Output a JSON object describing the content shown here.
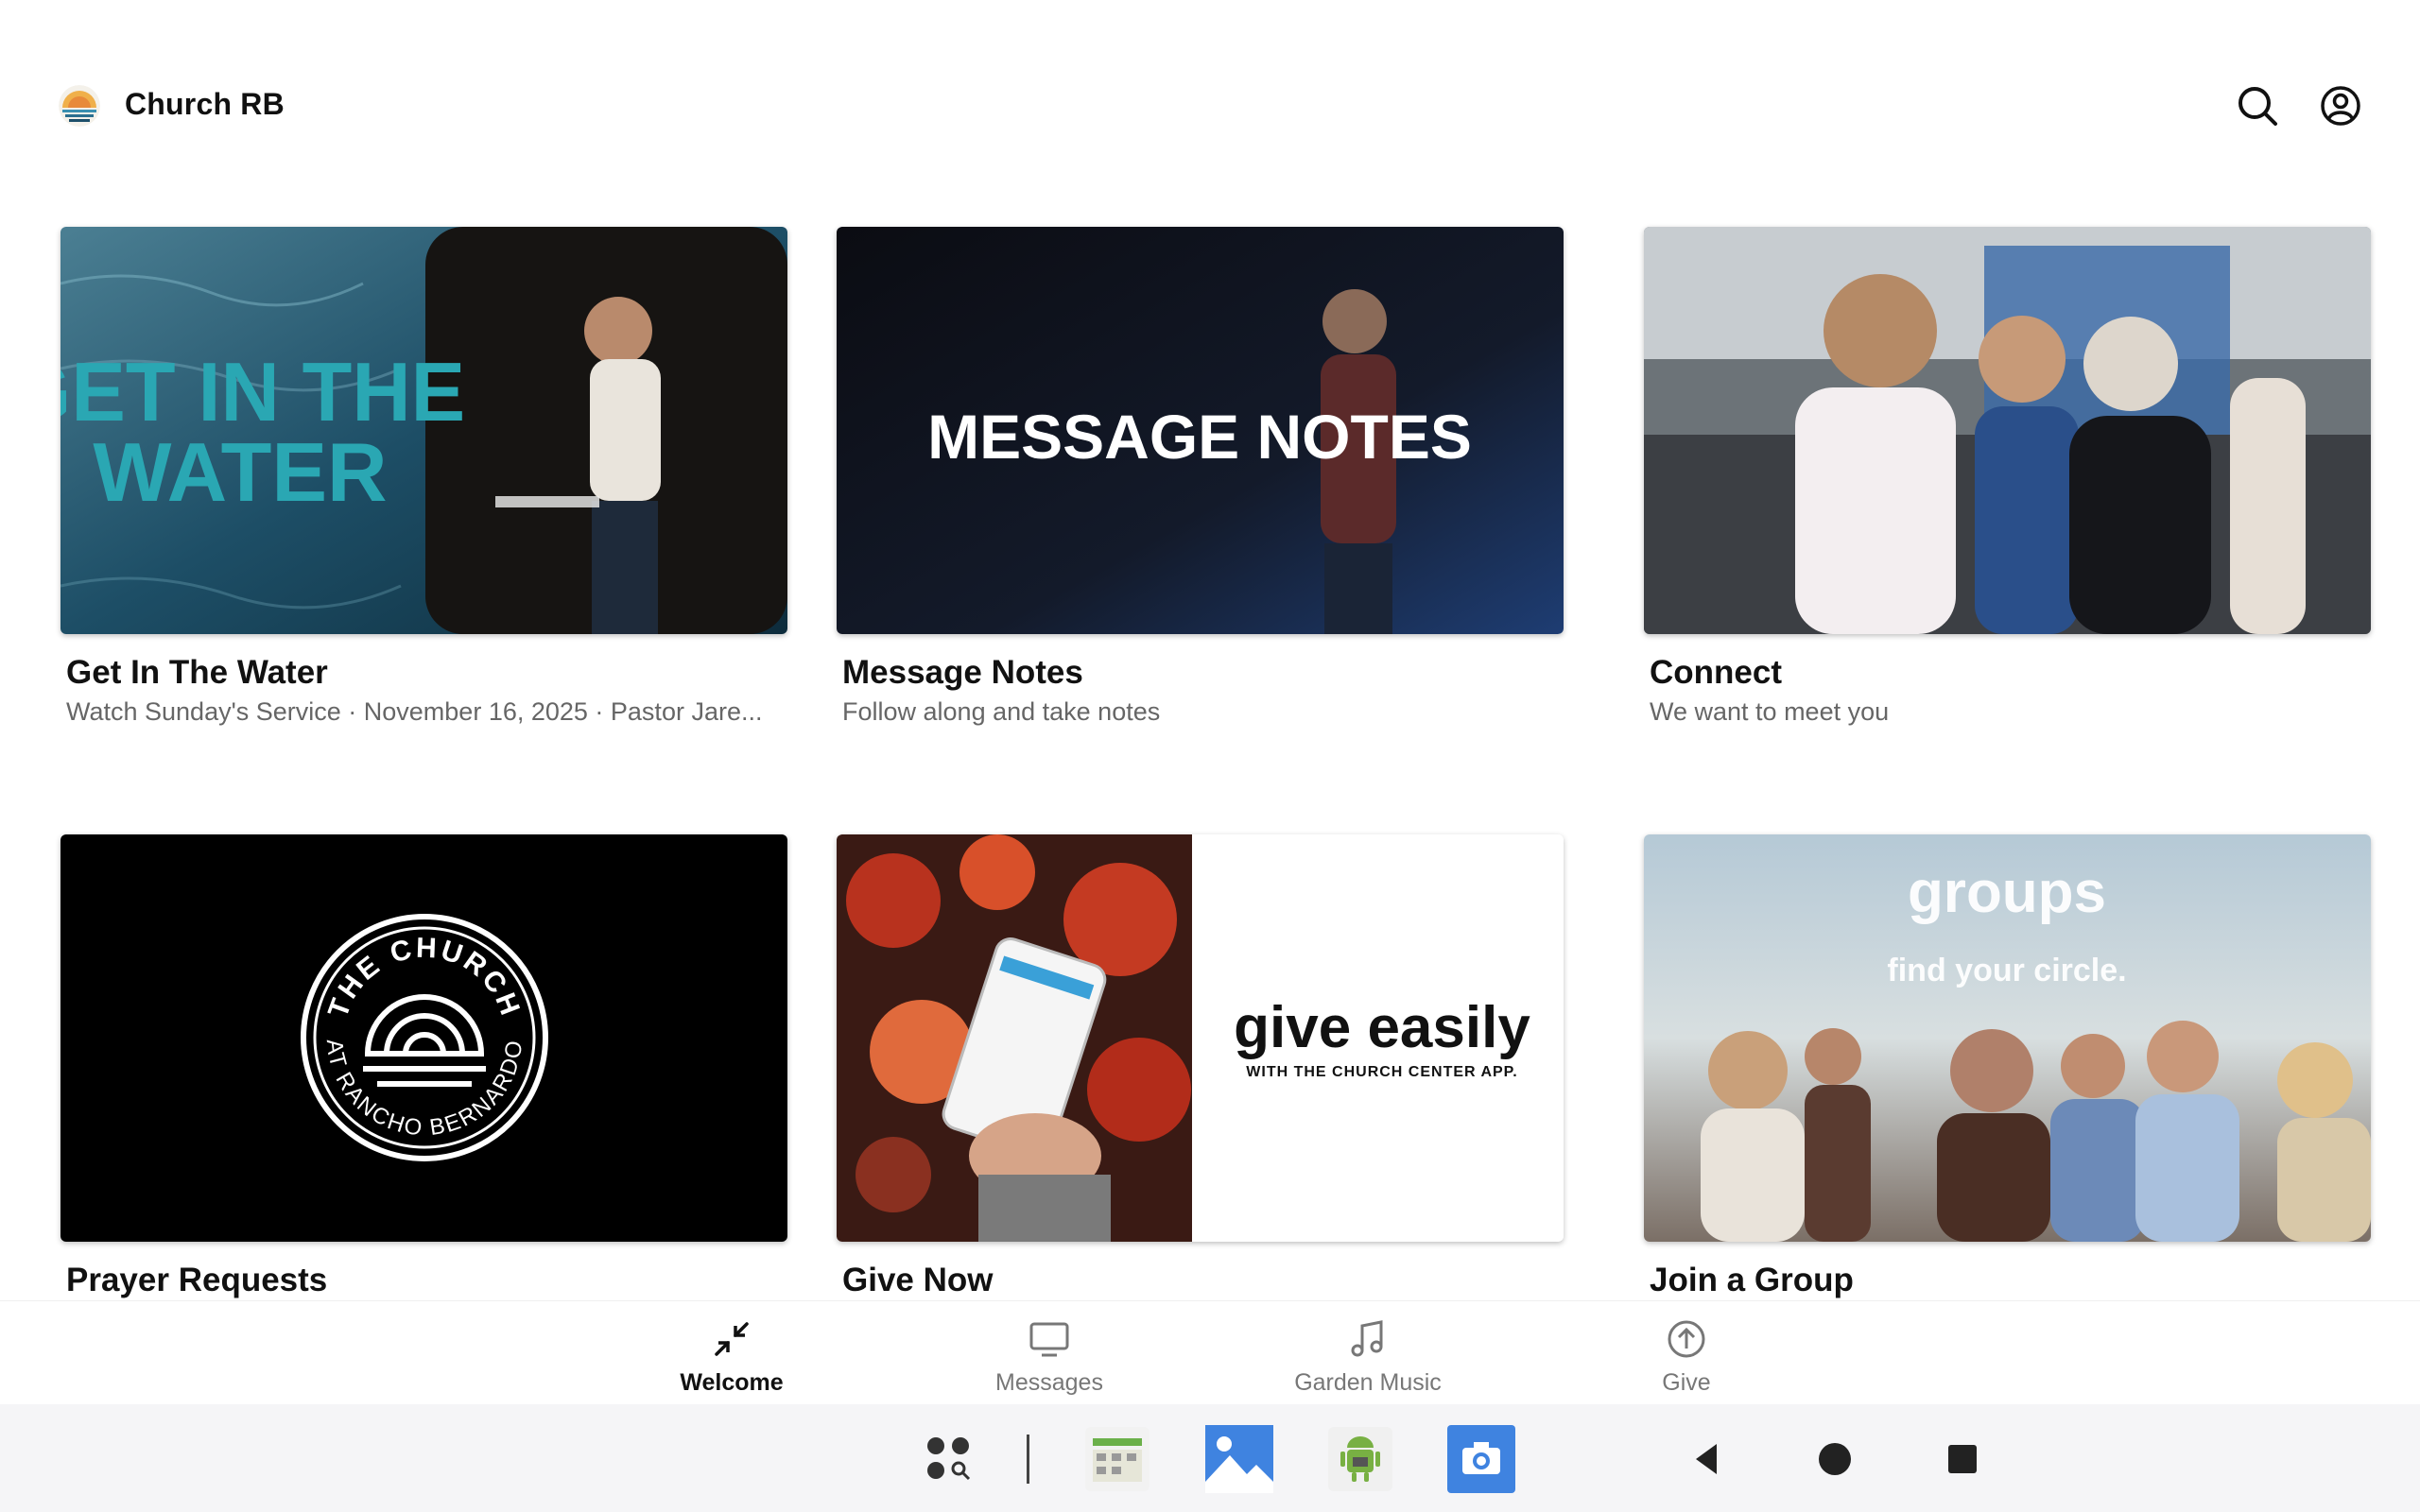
{
  "header": {
    "app_title": "Church RB",
    "icons": [
      "church-logo",
      "search-icon",
      "account-icon"
    ]
  },
  "cards": [
    {
      "title": "Get In The Water",
      "subtitle": "Watch Sunday's Service · November 16, 2025 · Pastor Jare...",
      "image_text": [
        "GET IN THE",
        "WATER"
      ]
    },
    {
      "title": "Message Notes",
      "subtitle": "Follow along and take notes",
      "image_text": [
        "MESSAGE NOTES"
      ]
    },
    {
      "title": "Connect",
      "subtitle": "We want to meet you",
      "image_text": []
    },
    {
      "title": "Prayer Requests",
      "subtitle": "",
      "image_text": [
        "THE CHURCH",
        "AT RANCHO BERNARDO"
      ]
    },
    {
      "title": "Give Now",
      "subtitle": "",
      "image_text": [
        "give easily",
        "WITH THE CHURCH CENTER APP."
      ]
    },
    {
      "title": "Join a Group",
      "subtitle": "",
      "image_text": [
        "groups",
        "find your circle."
      ]
    }
  ],
  "tabs": [
    {
      "label": "Welcome",
      "icon": "collapse-arrows-icon",
      "active": true
    },
    {
      "label": "Messages",
      "icon": "monitor-icon",
      "active": false
    },
    {
      "label": "Garden Music",
      "icon": "music-note-icon",
      "active": false
    },
    {
      "label": "Give",
      "icon": "arrow-up-circle-icon",
      "active": false
    }
  ],
  "system_bar": {
    "apps": [
      "app-drawer-icon",
      "calendar-app-icon",
      "gallery-app-icon",
      "android-app-icon",
      "camera-app-icon"
    ],
    "nav": [
      "back-icon",
      "home-icon",
      "recents-icon"
    ]
  },
  "colors": {
    "accent": "#111111",
    "inactive": "#777777",
    "system_bar": "#f5f5f7"
  }
}
